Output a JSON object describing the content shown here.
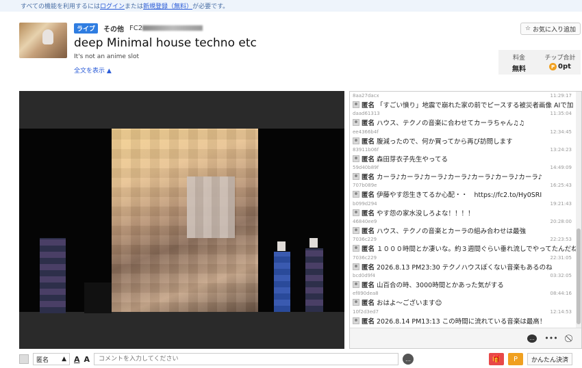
{
  "notice": {
    "prefix": "すべての機能を利用するには",
    "login": "ログイン",
    "or": "または",
    "signup": "新規登録（無料）",
    "suffix": "が必要です。"
  },
  "stream": {
    "live_badge": "ライブ",
    "category": "その他",
    "channel_prefix": "FC2",
    "title": "deep Minimal house techno etc",
    "subtitle": "It's not an anime slot",
    "more_label": "全文を表示 ▲"
  },
  "favorite": {
    "label": "お気に入り追加"
  },
  "price": {
    "fee_label": "料金",
    "fee_value": "無料",
    "tip_label": "チップ合計",
    "tip_value": "0pt"
  },
  "chat": {
    "messages": [
      {
        "uid": "8aa27dacx",
        "time": "11:29:17",
        "name": "匿名",
        "text": "「すごい憤り」地震で崩れた家の前でピースする被災者画像 AIで加"
      },
      {
        "uid": "daad61313",
        "time": "11:35:04",
        "name": "匿名",
        "text": "ハウス、テクノの音楽に合わせてカーラちゃん♫♫"
      },
      {
        "uid": "ee4366b4f",
        "time": "12:34:45",
        "name": "匿名",
        "text": "腹減ったので、何か買ってから再び訪問します"
      },
      {
        "uid": "83911b06f",
        "time": "13:24:23",
        "name": "匿名",
        "text": "森田芽衣子先生やってる"
      },
      {
        "uid": "59d40b89f",
        "time": "14:49:09",
        "name": "匿名",
        "text": "カーラ♪カーラ♪カーラ♪カーラ♪カーラ♪カーラ♪カーラ♪"
      },
      {
        "uid": "707b089e",
        "time": "16:25:43",
        "name": "匿名",
        "text": "伊藤やす怨生きてるか心配・・　https://fc2.to/Hy0SRI"
      },
      {
        "uid": "b099d294",
        "time": "19:21:43",
        "name": "匿名",
        "text": "やす怨の家水没しろよな！！！！"
      },
      {
        "uid": "46840ee9",
        "time": "20:28:00",
        "name": "匿名",
        "text": "ハウス、テクノの音楽とカーラの組み合わせは最強"
      },
      {
        "uid": "7036c229",
        "time": "22:23:53",
        "name": "匿名",
        "text": "１０００時間とか凄いな。約３週間ぐらい垂れ流しでやってたんだね"
      },
      {
        "uid": "7036c229",
        "time": "22:31:05",
        "name": "匿名",
        "text": "2026.8.13 PM23:30 テクノハウスぽくない音楽もあるのね"
      },
      {
        "uid": "bcd0d9f4",
        "time": "03:32:05",
        "name": "匿名",
        "text": "山百合の時、3000時間とかあった気がする"
      },
      {
        "uid": "ef890dea8",
        "time": "08:44:16",
        "name": "匿名",
        "text": "おはよ～ございます😊"
      },
      {
        "uid": "10f2d3ed7",
        "time": "12:14:53",
        "name": "匿名",
        "text": "2026.8.14 PM13:13 この時間に流れている音楽は最高！"
      }
    ]
  },
  "composer": {
    "anon_label": "匿名",
    "text_color_label": "A",
    "text_size_label": "A",
    "placeholder": "コメントを入力してください",
    "pay_label": "かんたん決済"
  },
  "colors": {
    "accent": "#2f7de1",
    "coin": "#f0a020",
    "gift": "#e84848"
  },
  "icons": [
    "chat-bubble-icon",
    "more-icon",
    "block-icon",
    "gift-icon",
    "point-icon",
    "send-icon",
    "star-icon"
  ]
}
